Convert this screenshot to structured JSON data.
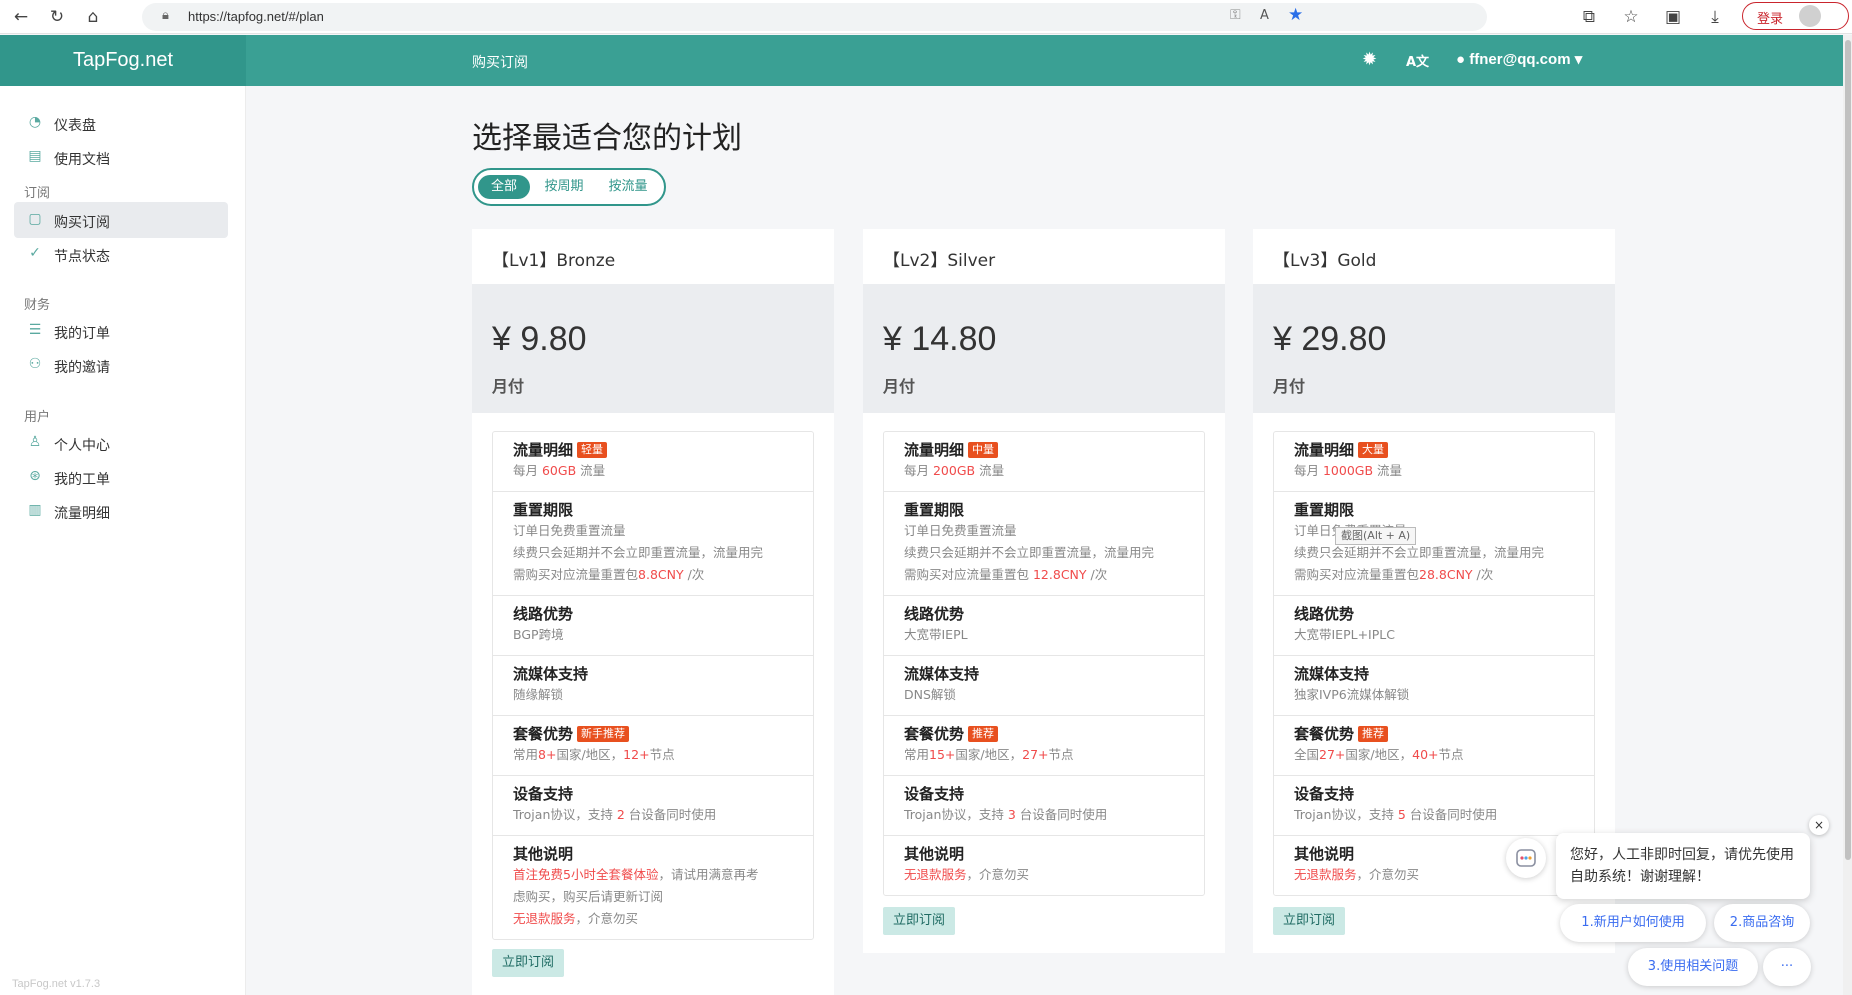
{
  "browser": {
    "url": "https://tapfog.net/#/plan",
    "login_label": "登录"
  },
  "header": {
    "brand": "TapFog.net",
    "title": "购买订阅",
    "user_email": "ffner@qq.com"
  },
  "sidebar": {
    "items_top": [
      {
        "label": "仪表盘",
        "icon": "dashboard-icon"
      },
      {
        "label": "使用文档",
        "icon": "book-icon"
      }
    ],
    "section_subscribe": "订阅",
    "items_subscribe": [
      {
        "label": "购买订阅",
        "icon": "clipboard-icon",
        "active": true
      },
      {
        "label": "节点状态",
        "icon": "check-circle-icon"
      }
    ],
    "section_finance": "财务",
    "items_finance": [
      {
        "label": "我的订单",
        "icon": "list-icon"
      },
      {
        "label": "我的邀请",
        "icon": "user-add-icon"
      }
    ],
    "section_user": "用户",
    "items_user": [
      {
        "label": "个人中心",
        "icon": "user-icon"
      },
      {
        "label": "我的工单",
        "icon": "support-icon"
      },
      {
        "label": "流量明细",
        "icon": "bar-chart-icon"
      }
    ],
    "version": "TapFog.net v1.7.3"
  },
  "main": {
    "title": "选择最适合您的计划",
    "filters": [
      "全部",
      "按周期",
      "按流量"
    ],
    "active_filter": "全部"
  },
  "plans": [
    {
      "name": "【Lv1】Bronze",
      "price": "¥ 9.80",
      "period": "月付",
      "traffic_title": "流量明细",
      "traffic_tag": "轻量",
      "traffic_pre": "每月 ",
      "traffic_amount": "60GB",
      "traffic_post": " 流量",
      "reset_title": "重置期限",
      "reset_line1": "订单日免费重置流量",
      "reset_line2": "续费只会延期并不会立即重置流量，流量用完",
      "reset_line3_pre": "需购买对应流量重置包",
      "reset_price": "8.8CNY",
      "reset_line3_post": " /次",
      "route_title": "线路优势",
      "route_desc": "BGP跨境",
      "media_title": "流媒体支持",
      "media_desc": "随缘解锁",
      "pkg_title": "套餐优势",
      "pkg_tag": "新手推荐",
      "pkg_pre": "常用",
      "pkg_countries": "8+",
      "pkg_mid": "国家/地区，",
      "pkg_nodes": "12+",
      "pkg_post": "节点",
      "device_title": "设备支持",
      "device_pre": "Trojan协议，支持 ",
      "device_count": "2",
      "device_post": " 台设备同时使用",
      "other_title": "其他说明",
      "other_red1": "首注免费5小时全套餐体验",
      "other_rest1": "，请试用满意再考",
      "other_line2": "虑购买，购买后请更新订阅",
      "other_red2": "无退款服务",
      "other_rest2": "，介意勿买",
      "button": "立即订阅"
    },
    {
      "name": "【Lv2】Silver",
      "price": "¥ 14.80",
      "period": "月付",
      "traffic_title": "流量明细",
      "traffic_tag": "中量",
      "traffic_pre": "每月 ",
      "traffic_amount": "200GB",
      "traffic_post": " 流量",
      "reset_title": "重置期限",
      "reset_line1": "订单日免费重置流量",
      "reset_line2": "续费只会延期并不会立即重置流量，流量用完",
      "reset_line3_pre": "需购买对应流量重置包 ",
      "reset_price": "12.8CNY",
      "reset_line3_post": " /次",
      "route_title": "线路优势",
      "route_desc": "大宽带IEPL",
      "media_title": "流媒体支持",
      "media_desc": "DNS解锁",
      "pkg_title": "套餐优势",
      "pkg_tag": "推荐",
      "pkg_pre": "常用",
      "pkg_countries": "15+",
      "pkg_mid": "国家/地区，",
      "pkg_nodes": "27+",
      "pkg_post": "节点",
      "device_title": "设备支持",
      "device_pre": "Trojan协议，支持 ",
      "device_count": "3",
      "device_post": " 台设备同时使用",
      "other_title": "其他说明",
      "other_red2": "无退款服务",
      "other_rest2": "，介意勿买",
      "button": "立即订阅"
    },
    {
      "name": "【Lv3】Gold",
      "price": "¥ 29.80",
      "period": "月付",
      "traffic_title": "流量明细",
      "traffic_tag": "大量",
      "traffic_pre": "每月 ",
      "traffic_amount": "1000GB",
      "traffic_post": " 流量",
      "reset_title": "重置期限",
      "reset_line1": "订单日免费重置流量",
      "reset_line2": "续费只会延期并不会立即重置流量，流量用完",
      "reset_line3_pre": "需购买对应流量重置包",
      "reset_price": "28.8CNY",
      "reset_line3_post": " /次",
      "route_title": "线路优势",
      "route_desc": "大宽带IEPL+IPLC",
      "media_title": "流媒体支持",
      "media_desc": "独家IVP6流媒体解锁",
      "pkg_title": "套餐优势",
      "pkg_tag": "推荐",
      "pkg_pre": "全国",
      "pkg_countries": "27+",
      "pkg_mid": "国家/地区，",
      "pkg_nodes": "40+",
      "pkg_post": "节点",
      "device_title": "设备支持",
      "device_pre": "Trojan协议，支持 ",
      "device_count": "5",
      "device_post": " 台设备同时使用",
      "other_title": "其他说明",
      "other_red2": "无退款服务",
      "other_rest2": "，介意勿买",
      "button": "立即订阅"
    }
  ],
  "tooltip": "截图(Alt + A)",
  "chat": {
    "message": "您好，人工非即时回复，请优先使用自助系统！谢谢理解！",
    "chips": [
      "1.新用户如何使用",
      "2.商品咨询",
      "3.使用相关问题",
      "···"
    ],
    "close": "×"
  },
  "colors": {
    "brand": "#31968b",
    "tag": "#e8501f",
    "highlight": "#f04b4b"
  }
}
